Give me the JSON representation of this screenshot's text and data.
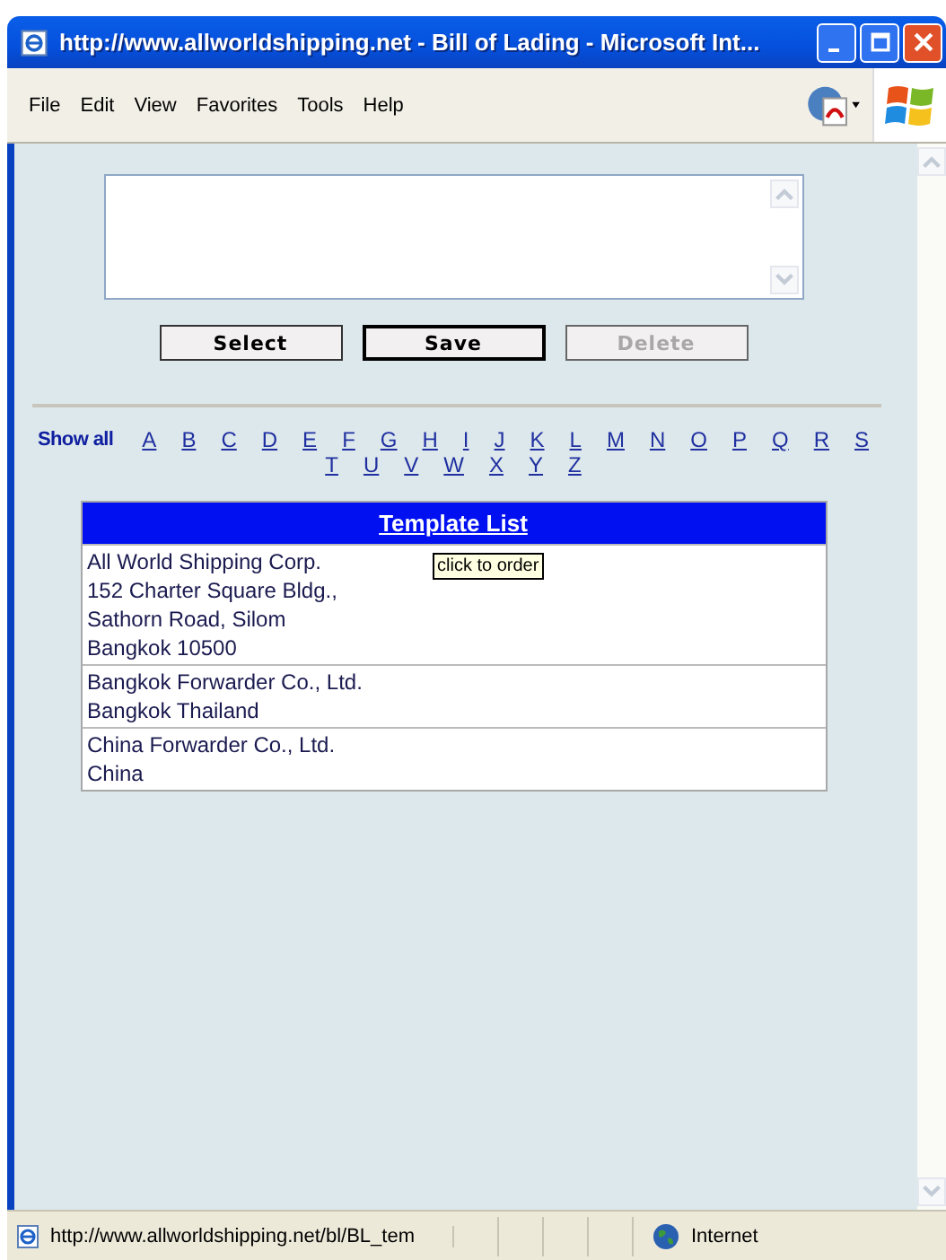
{
  "window": {
    "title": "http://www.allworldshipping.net - Bill of Lading - Microsoft Int..."
  },
  "menu": [
    "File",
    "Edit",
    "View",
    "Favorites",
    "Tools",
    "Help"
  ],
  "buttons": [
    {
      "label": "Select",
      "disabled": false,
      "focused": false
    },
    {
      "label": "Save",
      "disabled": false,
      "focused": true
    },
    {
      "label": "Delete",
      "disabled": true,
      "focused": false
    }
  ],
  "filter": {
    "show_all": "Show all",
    "letters": [
      "A",
      "B",
      "C",
      "D",
      "E",
      "F",
      "G",
      "H",
      "I",
      "J",
      "K",
      "L",
      "M",
      "N",
      "O",
      "P",
      "Q",
      "R",
      "S",
      "T",
      "U",
      "V",
      "W",
      "X",
      "Y",
      "Z"
    ]
  },
  "template_list": {
    "title": "Template List",
    "tooltip": "click to order",
    "rows": [
      {
        "lines": [
          "All World Shipping Corp.",
          "152 Charter Square Bldg.,",
          "Sathorn Road, Silom",
          "Bangkok 10500"
        ]
      },
      {
        "lines": [
          "Bangkok Forwarder Co., Ltd.",
          "Bangkok Thailand"
        ]
      },
      {
        "lines": [
          "China Forwarder Co., Ltd.",
          "China"
        ]
      }
    ]
  },
  "status_bar": {
    "url": "http://www.allworldshipping.net/bl/BL_tem",
    "zone": "Internet"
  }
}
